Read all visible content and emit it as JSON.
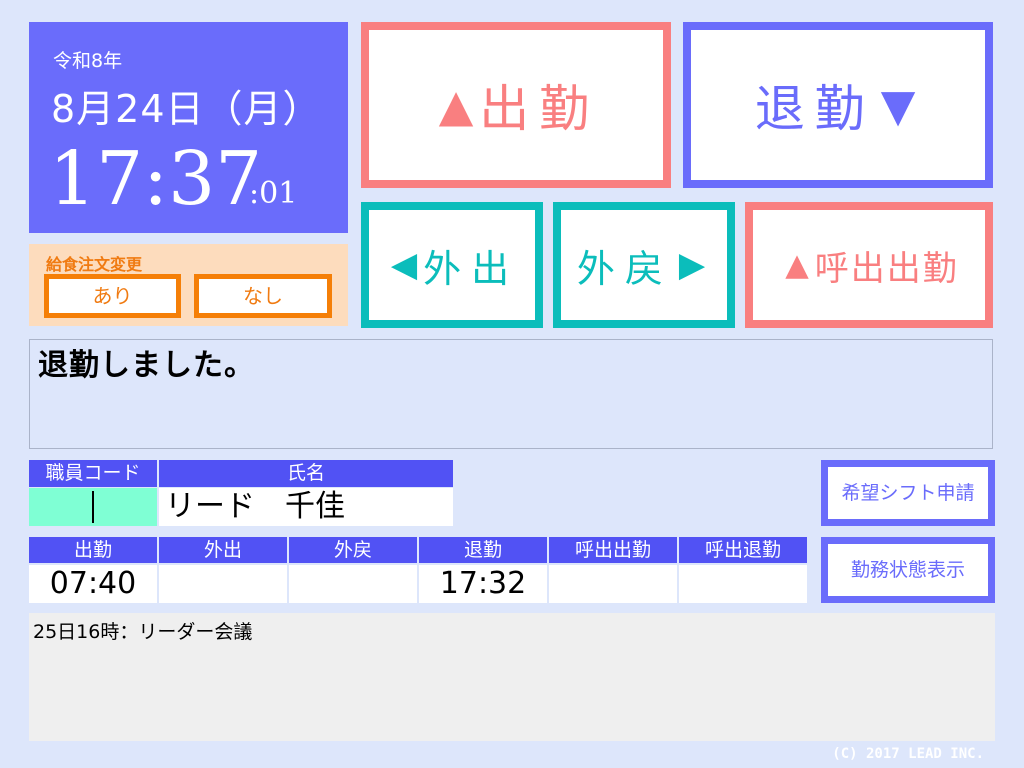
{
  "clock": {
    "era": "令和8年",
    "date": "8月24日（月）",
    "time": "17:37",
    "seconds": ":01"
  },
  "meal": {
    "title": "給食注文変更",
    "yes": "あり",
    "no": "なし"
  },
  "actions": {
    "clock_in": {
      "label": "出勤",
      "arrow": "▲"
    },
    "clock_out": {
      "label": "退勤",
      "arrow": "▼"
    },
    "go_out": {
      "label": "外出",
      "arrow": "◀"
    },
    "return": {
      "label": "外戻",
      "arrow": "▶"
    },
    "call_in": {
      "label": "呼出出勤",
      "arrow": "▲"
    }
  },
  "message": "退勤しました。",
  "staff": {
    "code_header": "職員コード",
    "name_header": "氏名",
    "code_value": "",
    "name": "リード　千佳"
  },
  "times": {
    "headers": [
      "出勤",
      "外出",
      "外戻",
      "退勤",
      "呼出出勤",
      "呼出退勤"
    ],
    "values": [
      "07:40",
      "",
      "",
      "17:32",
      "",
      ""
    ]
  },
  "side": {
    "shift_request": "希望シフト申請",
    "work_status": "勤務状態表示"
  },
  "notice": "25日16時：リーダー会議",
  "copyright": "(C) 2017 LEAD INC.",
  "colors": {
    "background": "#dde6fb",
    "blue": "#6a6cfb",
    "red": "#f97f80",
    "teal": "#0bbdbb",
    "orange": "#f57f07",
    "header": "#5152f4"
  }
}
